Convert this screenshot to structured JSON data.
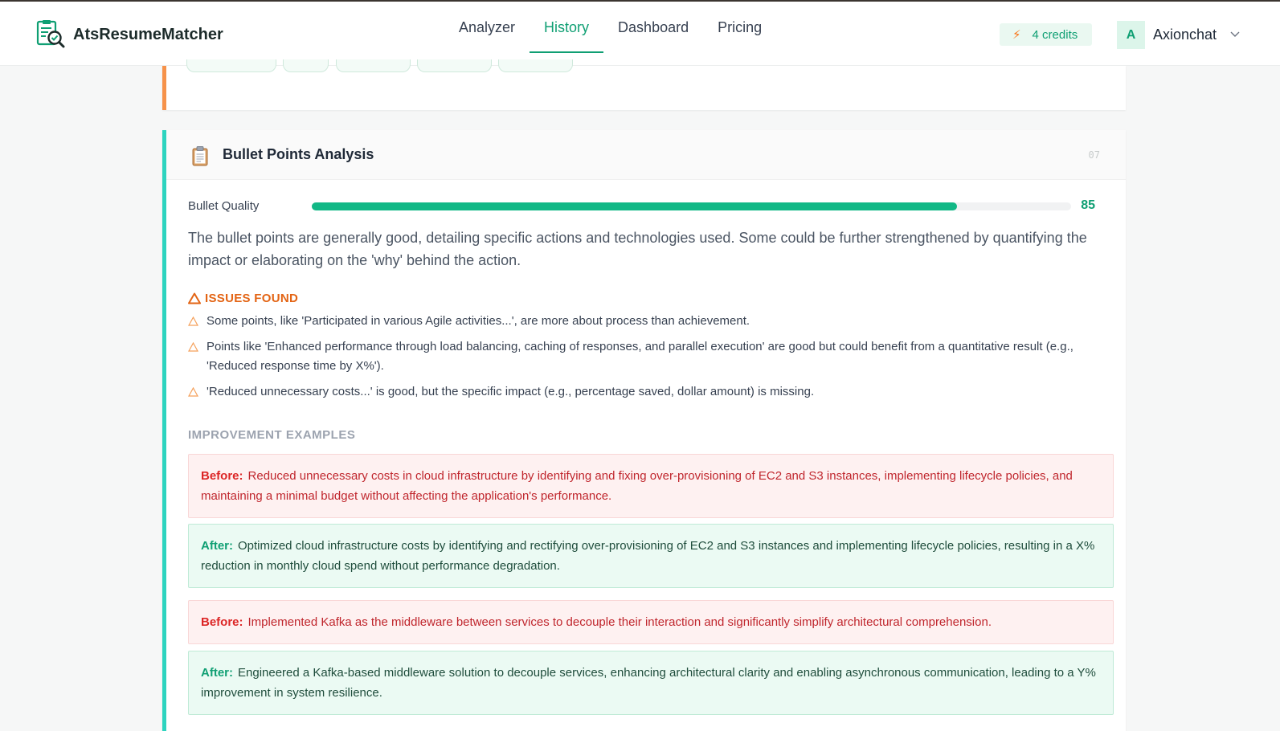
{
  "app": {
    "name": "AtsResumeMatcher",
    "accent": "#0f9f73"
  },
  "nav": {
    "items": [
      {
        "label": "Analyzer"
      },
      {
        "label": "History"
      },
      {
        "label": "Dashboard"
      },
      {
        "label": "Pricing"
      }
    ],
    "active": "History"
  },
  "user": {
    "credits": "4 credits",
    "avatar_initial": "A",
    "name": "Axionchat"
  },
  "section": {
    "icon": "clipboard-icon",
    "title": "Bullet Points Analysis",
    "number": "07",
    "metric": {
      "label": "Bullet Quality",
      "value": "85",
      "fraction": 0.85
    },
    "summary": "The bullet points are generally good, detailing specific actions and technologies used. Some could be further strengthened by quantifying the impact or elaborating on the 'why' behind the action.",
    "issues_title": "ISSUES FOUND",
    "issues": [
      "Some points, like 'Participated in various Agile activities...', are more about process than achievement.",
      "Points like 'Enhanced performance through load balancing, caching of responses, and parallel execution' are good but could benefit from a quantitative result (e.g., 'Reduced response time by X%').",
      "'Reduced unnecessary costs...' is good, but the specific impact (e.g., percentage saved, dollar amount) is missing."
    ],
    "examples_title": "IMPROVEMENT EXAMPLES",
    "examples": [
      {
        "before_label": "Before:",
        "before": "Reduced unnecessary costs in cloud infrastructure by identifying and fixing over-provisioning of EC2 and S3 instances, implementing lifecycle policies, and maintaining a minimal budget without affecting the application's performance.",
        "after_label": "After:",
        "after": "Optimized cloud infrastructure costs by identifying and rectifying over-provisioning of EC2 and S3 instances and implementing lifecycle policies, resulting in a X% reduction in monthly cloud spend without performance degradation."
      },
      {
        "before_label": "Before:",
        "before": "Implemented Kafka as the middleware between services to decouple their interaction and significantly simplify architectural comprehension.",
        "after_label": "After:",
        "after": "Engineered a Kafka-based middleware solution to decouple services, enhancing architectural clarity and enabling asynchronous communication, leading to a Y% improvement in system resilience."
      }
    ]
  },
  "colors": {
    "issues": "#e36414",
    "before_bg": "#fef1f1",
    "after_bg": "#ebfaf3",
    "section_border": "#2dd4bf",
    "previous_section_border": "#f6924a"
  }
}
